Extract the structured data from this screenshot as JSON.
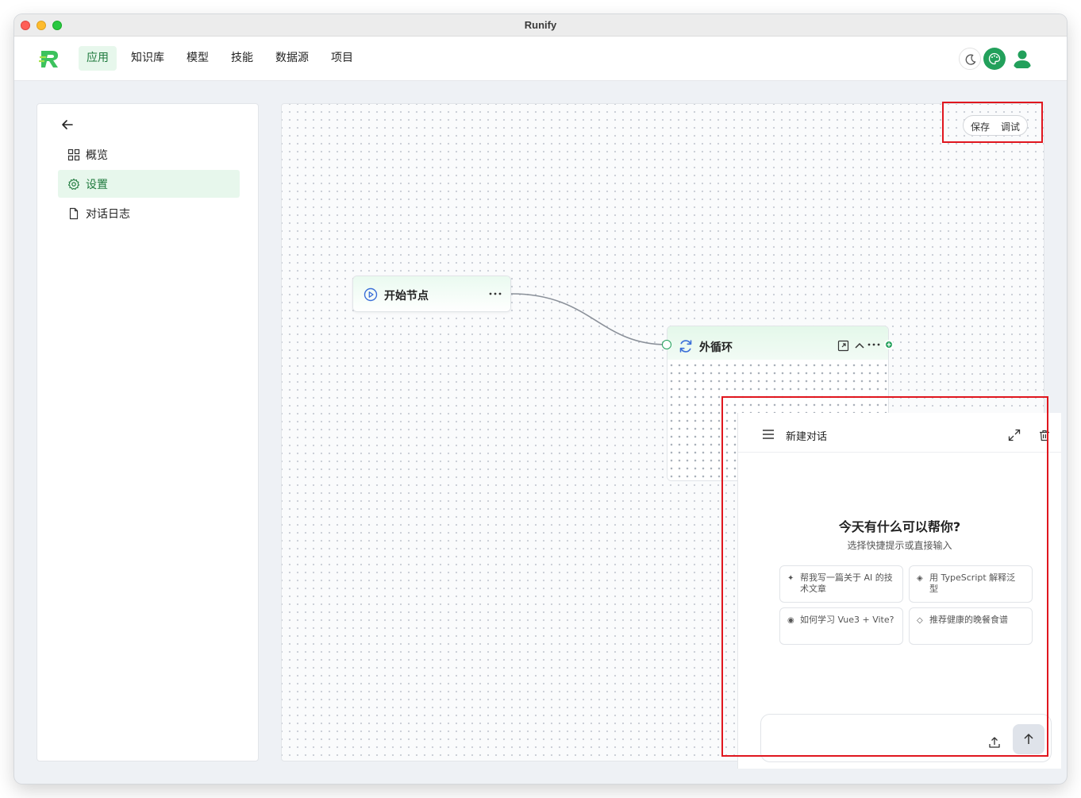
{
  "window": {
    "title": "Runify"
  },
  "nav": {
    "items": [
      {
        "label": "应用",
        "active": true
      },
      {
        "label": "知识库"
      },
      {
        "label": "模型"
      },
      {
        "label": "技能"
      },
      {
        "label": "数据源"
      },
      {
        "label": "项目"
      }
    ],
    "icons": [
      "moon-icon",
      "palette-icon",
      "user-icon"
    ]
  },
  "sidebar": {
    "items": [
      {
        "label": "概览",
        "icon": "grid-icon"
      },
      {
        "label": "设置",
        "icon": "gear-icon",
        "active": true
      },
      {
        "label": "对话日志",
        "icon": "file-icon"
      }
    ]
  },
  "canvas": {
    "save_label": "保存",
    "debug_label": "调试",
    "start_node": {
      "title": "开始节点"
    },
    "loop_node": {
      "title": "外循环"
    }
  },
  "chat": {
    "title": "新建对话",
    "heading": "今天有什么可以帮你?",
    "subheading": "选择快捷提示或直接输入",
    "suggestions": [
      {
        "mark": "✦",
        "text": "帮我写一篇关于 AI 的技术文章"
      },
      {
        "mark": "◈",
        "text": "用 TypeScript 解释泛型"
      },
      {
        "mark": "◉",
        "text": "如何学习 Vue3 + Vite?"
      },
      {
        "mark": "◇",
        "text": "推荐健康的晚餐食谱"
      }
    ],
    "input_placeholder": ""
  },
  "colors": {
    "accent": "#22a05b",
    "active_bg": "#e7f7ec",
    "highlight_box": "#e0161e"
  }
}
